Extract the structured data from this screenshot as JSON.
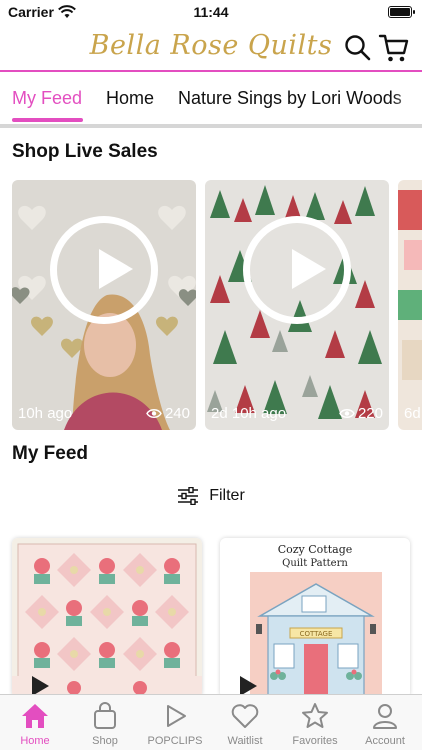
{
  "status_bar": {
    "carrier": "Carrier",
    "time": "11:44"
  },
  "header": {
    "logo": "Bella Rose Quilts",
    "accent_color": "#e34ec0",
    "logo_color": "#c9a44c",
    "search_icon": "search-icon",
    "cart_icon": "cart-icon"
  },
  "tabs": [
    {
      "label": "My Feed",
      "active": true
    },
    {
      "label": "Home",
      "active": false
    },
    {
      "label": "Nature Sings by Lori Woods",
      "active": false
    }
  ],
  "live_sales": {
    "title": "Shop Live Sales",
    "cards": [
      {
        "age": "10h ago",
        "views": "240"
      },
      {
        "age": "2d 10h ago",
        "views": "220"
      },
      {
        "age": "6d",
        "views": ""
      }
    ]
  },
  "feed": {
    "title": "My Feed",
    "filter_label": "Filter",
    "cards": [
      {
        "title": ""
      },
      {
        "title": "Cozy Cottage",
        "subtitle": "Quilt Pattern",
        "sign": "COTTAGE"
      }
    ]
  },
  "tab_bar": [
    {
      "label": "Home",
      "icon": "house-icon",
      "active": true
    },
    {
      "label": "Shop",
      "icon": "bag-icon",
      "active": false
    },
    {
      "label": "POPCLIPS",
      "icon": "play-icon",
      "active": false
    },
    {
      "label": "Waitlist",
      "icon": "heart-icon",
      "active": false
    },
    {
      "label": "Favorites",
      "icon": "star-icon",
      "active": false
    },
    {
      "label": "Account",
      "icon": "person-icon",
      "active": false
    }
  ]
}
